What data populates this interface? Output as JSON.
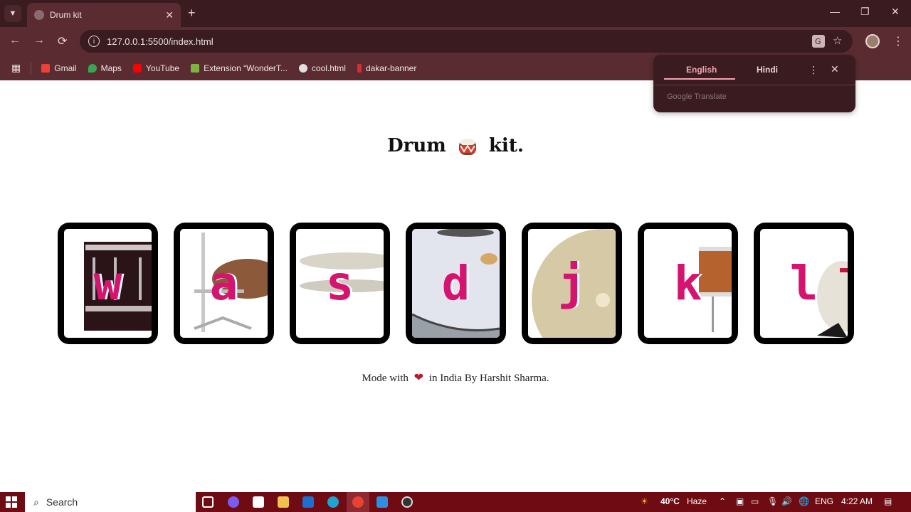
{
  "browser": {
    "tab_title": "Drum kit",
    "url": "127.0.0.1:5500/index.html",
    "bookmarks": [
      {
        "label": "Gmail",
        "icon": "gmail-icon",
        "color": "#ea4335"
      },
      {
        "label": "Maps",
        "icon": "maps-icon",
        "color": "#34a853"
      },
      {
        "label": "YouTube",
        "icon": "youtube-icon",
        "color": "#ff0000"
      },
      {
        "label": "Extension “WonderT...",
        "icon": "download-icon",
        "color": "#7cb342"
      },
      {
        "label": "cool.html",
        "icon": "globe-icon",
        "color": "#e0e0e0"
      },
      {
        "label": "dakar-banner",
        "icon": "bookmark-icon",
        "color": "#d32f2f"
      }
    ]
  },
  "translate": {
    "lang_active": "English",
    "lang_other": "Hindi",
    "brand": "Google Translate"
  },
  "page": {
    "title_left": "Drum",
    "title_right": "kit.",
    "pads": [
      {
        "key": "w",
        "image": "tom-drum"
      },
      {
        "key": "a",
        "image": "crash-cymbal-stand"
      },
      {
        "key": "s",
        "image": "hi-hat"
      },
      {
        "key": "d",
        "image": "snare"
      },
      {
        "key": "j",
        "image": "crash-cymbal"
      },
      {
        "key": "k",
        "image": "floor-tom"
      },
      {
        "key": "l",
        "image": "kick-drum"
      }
    ],
    "footer_before": "Mode with",
    "footer_after": "in India By Harshit Sharma."
  },
  "taskbar": {
    "search_placeholder": "Search",
    "weather": "40°C",
    "weather_desc": "Haze",
    "lang": "ENG",
    "time": "4:22 AM"
  },
  "colors": {
    "accent_key": "#d4146e",
    "chrome_dark": "#3a1c20",
    "chrome": "#5a2c31",
    "taskbar": "#6e0b13"
  }
}
